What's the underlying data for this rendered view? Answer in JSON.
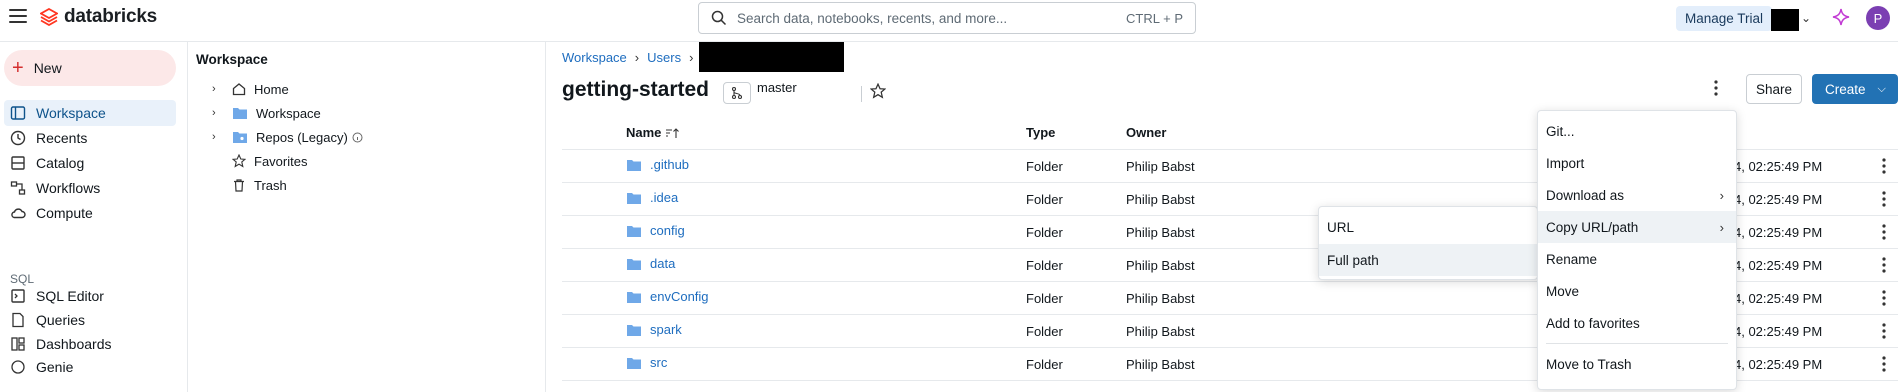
{
  "header": {
    "logo_text": "databricks",
    "search_placeholder": "Search data, notebooks, recents, and more...",
    "search_shortcut": "CTRL + P",
    "manage_trial": "Manage Trial",
    "avatar_initial": "P"
  },
  "nav": {
    "new_label": "New",
    "items": [
      {
        "label": "Workspace",
        "icon": "workspace-icon"
      },
      {
        "label": "Recents",
        "icon": "clock-icon"
      },
      {
        "label": "Catalog",
        "icon": "catalog-icon"
      },
      {
        "label": "Workflows",
        "icon": "workflows-icon"
      },
      {
        "label": "Compute",
        "icon": "cloud-icon"
      }
    ],
    "sql_section": "SQL",
    "sql_items": [
      {
        "label": "SQL Editor",
        "icon": "sql-editor-icon"
      },
      {
        "label": "Queries",
        "icon": "queries-icon"
      },
      {
        "label": "Dashboards",
        "icon": "dashboards-icon"
      },
      {
        "label": "Genie",
        "icon": "genie-icon"
      }
    ]
  },
  "tree": {
    "title": "Workspace",
    "items": [
      {
        "label": "Home",
        "icon": "home-icon"
      },
      {
        "label": "Workspace",
        "icon": "folder-icon"
      },
      {
        "label": "Repos (Legacy)",
        "icon": "repos-icon"
      },
      {
        "label": "Favorites",
        "icon": "star-icon"
      },
      {
        "label": "Trash",
        "icon": "trash-icon"
      }
    ]
  },
  "breadcrumb": [
    "Workspace",
    "Users"
  ],
  "page": {
    "title": "getting-started",
    "branch": "master",
    "share": "Share",
    "create": "Create"
  },
  "table": {
    "columns": [
      "Name",
      "Type",
      "Owner"
    ],
    "rows": [
      {
        "name": ".github",
        "type": "Folder",
        "owner": "Philip Babst",
        "date": "4, 02:25:49 PM"
      },
      {
        "name": ".idea",
        "type": "Folder",
        "owner": "Philip Babst",
        "date": "4, 02:25:49 PM"
      },
      {
        "name": "config",
        "type": "Folder",
        "owner": "Philip Babst",
        "date": "4, 02:25:49 PM"
      },
      {
        "name": "data",
        "type": "Folder",
        "owner": "Philip Babst",
        "date": "4, 02:25:49 PM"
      },
      {
        "name": "envConfig",
        "type": "Folder",
        "owner": "Philip Babst",
        "date": "4, 02:25:49 PM"
      },
      {
        "name": "spark",
        "type": "Folder",
        "owner": "Philip Babst",
        "date": "4, 02:25:49 PM"
      },
      {
        "name": "src",
        "type": "Folder",
        "owner": "Philip Babst",
        "date": "4, 02:25:49 PM"
      }
    ]
  },
  "context_menu": {
    "items": [
      "Git...",
      "Import",
      "Download as",
      "Copy URL/path",
      "Rename",
      "Move",
      "Add to favorites",
      "Move to Trash"
    ]
  },
  "submenu": {
    "items": [
      "URL",
      "Full path"
    ]
  },
  "colors": {
    "accent": "#2272b4",
    "link": "#1e6dbf",
    "folder": "#6fa8e8",
    "new_bg": "#fce8e8",
    "active_nav": "#e9f1fa"
  }
}
